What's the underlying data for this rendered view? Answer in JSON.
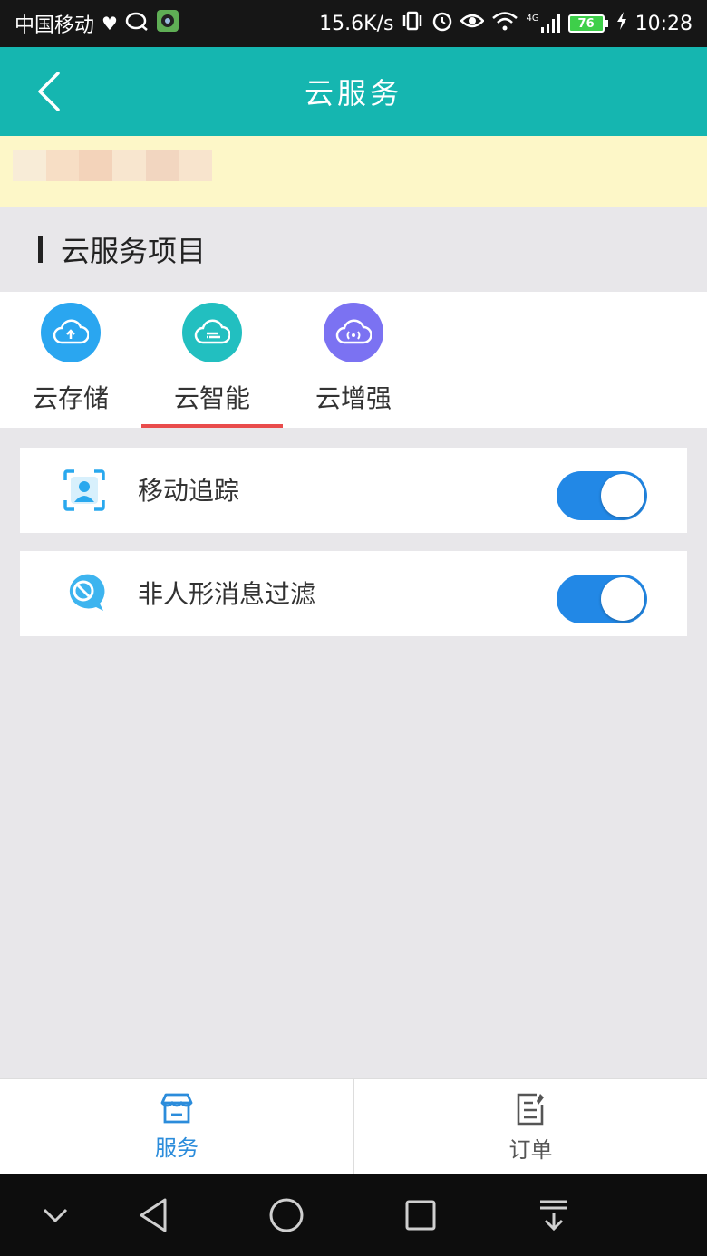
{
  "status_bar": {
    "carrier": "中国移动",
    "speed": "15.6K/s",
    "network": "4G",
    "battery": "76",
    "time": "10:28"
  },
  "header": {
    "title": "云服务"
  },
  "section": {
    "title": "云服务项目"
  },
  "tabs": [
    {
      "label": "云存储",
      "icon": "cloud-upload-icon",
      "color": "#2aa6f0",
      "active": false
    },
    {
      "label": "云智能",
      "icon": "cloud-smart-icon",
      "color": "#22bfc0",
      "active": true
    },
    {
      "label": "云增强",
      "icon": "cloud-signal-icon",
      "color": "#7b72f2",
      "active": false
    }
  ],
  "settings": [
    {
      "label": "移动追踪",
      "icon": "motion-tracking-icon",
      "enabled": true
    },
    {
      "label": "非人形消息过滤",
      "icon": "message-filter-icon",
      "enabled": true
    }
  ],
  "bottom_nav": [
    {
      "label": "服务",
      "icon": "store-icon",
      "active": true,
      "color": "#2b8cdb"
    },
    {
      "label": "订单",
      "icon": "order-icon",
      "active": false,
      "color": "#555555"
    }
  ],
  "colors": {
    "accent": "#15b6b0",
    "toggle_on": "#2288e6",
    "tab_indicator": "#e94c4c"
  }
}
